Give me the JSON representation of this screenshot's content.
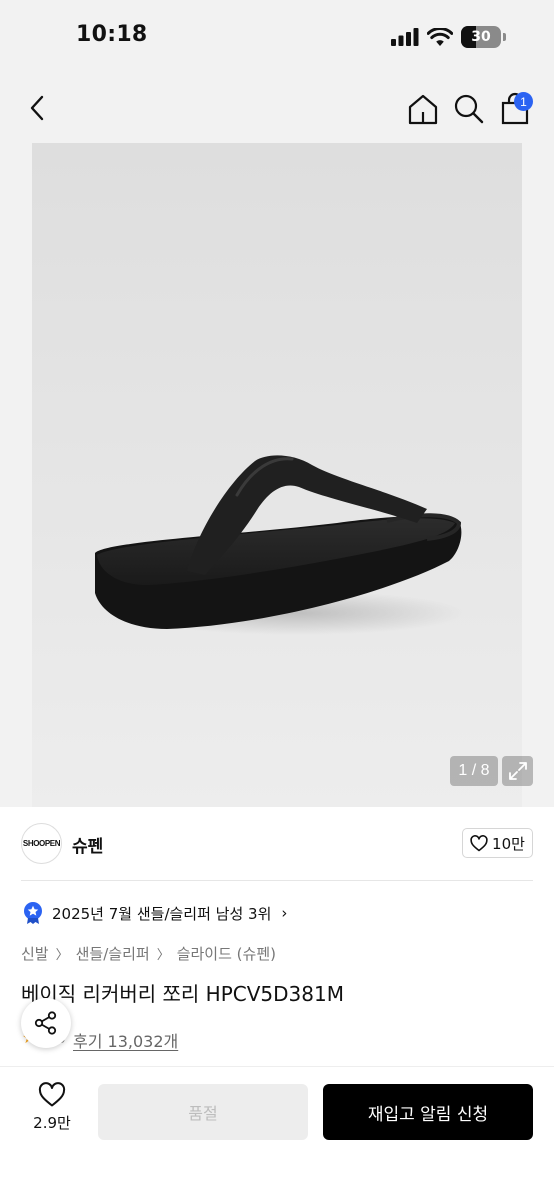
{
  "status_bar": {
    "time": "10:18",
    "battery": "30"
  },
  "nav": {
    "cart_count": "1"
  },
  "gallery": {
    "indicator": "1 / 8"
  },
  "brand": {
    "logo_text": "SHOOPEN",
    "name": "슈펜",
    "likes": "10만"
  },
  "ranking": {
    "text": "2025년 7월 샌들/슬리퍼 남성 3위"
  },
  "breadcrumb": [
    "신발",
    "샌들/슬리퍼",
    "슬라이드 (슈펜)"
  ],
  "product": {
    "title": "베이직 리커버리 쪼리 HPCV5D381M"
  },
  "review": {
    "rating": "8",
    "link": "후기 13,032개"
  },
  "bottom": {
    "wish_count": "2.9만",
    "soldout_label": "품절",
    "restock_label": "재입고 알림 신청"
  },
  "colors": {
    "accent_blue": "#2b63f2",
    "primary_black": "#000000",
    "star_yellow": "#f5a623"
  },
  "icons": [
    "back-icon",
    "home-icon",
    "search-icon",
    "shopping-bag-icon",
    "expand-icon",
    "heart-icon",
    "medal-icon",
    "share-icon"
  ]
}
